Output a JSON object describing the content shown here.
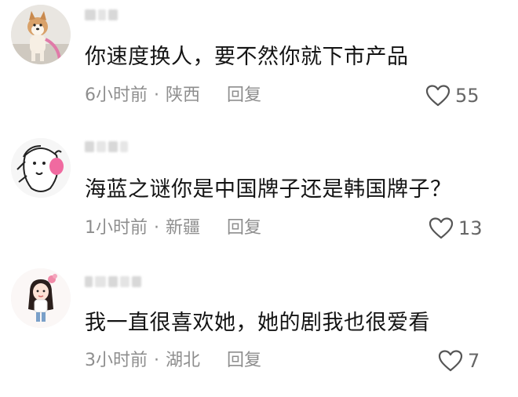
{
  "comments": [
    {
      "content": "你速度换人，要不然你就下市产品",
      "time": "6小时前",
      "separator": "·",
      "location": "陕西",
      "reply_label": "回复",
      "likes": "55",
      "avatar_icon": "shiba-dog-icon"
    },
    {
      "content": "海蓝之谜你是中国牌子还是韩国牌子？",
      "time": "1小时前",
      "separator": "·",
      "location": "新疆",
      "reply_label": "回复",
      "likes": "13",
      "avatar_icon": "cartoon-face-icon"
    },
    {
      "content": "我一直很喜欢她，她的剧我也很爱看",
      "time": "3小时前",
      "separator": "·",
      "location": "湖北",
      "reply_label": "回复",
      "likes": "7",
      "avatar_icon": "girl-illustration-icon"
    }
  ],
  "colors": {
    "text": "#141414",
    "meta": "#8e8e8e",
    "like_icon": "#555555"
  }
}
